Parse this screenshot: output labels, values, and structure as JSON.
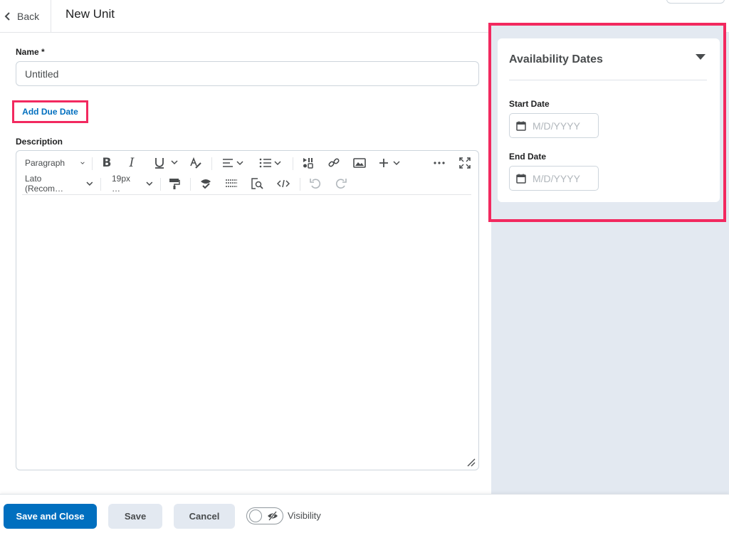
{
  "header": {
    "back_label": "Back",
    "title": "New Unit"
  },
  "form": {
    "name_label": "Name *",
    "name_value": "Untitled",
    "add_due_date": "Add Due Date",
    "description_label": "Description"
  },
  "editor": {
    "paragraph_select": "Paragraph",
    "font_select": "Lato (Recom…",
    "size_select": "19px …"
  },
  "availability": {
    "title": "Availability Dates",
    "start_label": "Start Date",
    "start_placeholder": "M/D/YYYY",
    "end_label": "End Date",
    "end_placeholder": "M/D/YYYY"
  },
  "footer": {
    "save_close": "Save and Close",
    "save": "Save",
    "cancel": "Cancel",
    "visibility_label": "Visibility"
  },
  "colors": {
    "primary": "#006fbf",
    "highlight": "#f2295f",
    "panel_bg": "#e3e9f1"
  }
}
